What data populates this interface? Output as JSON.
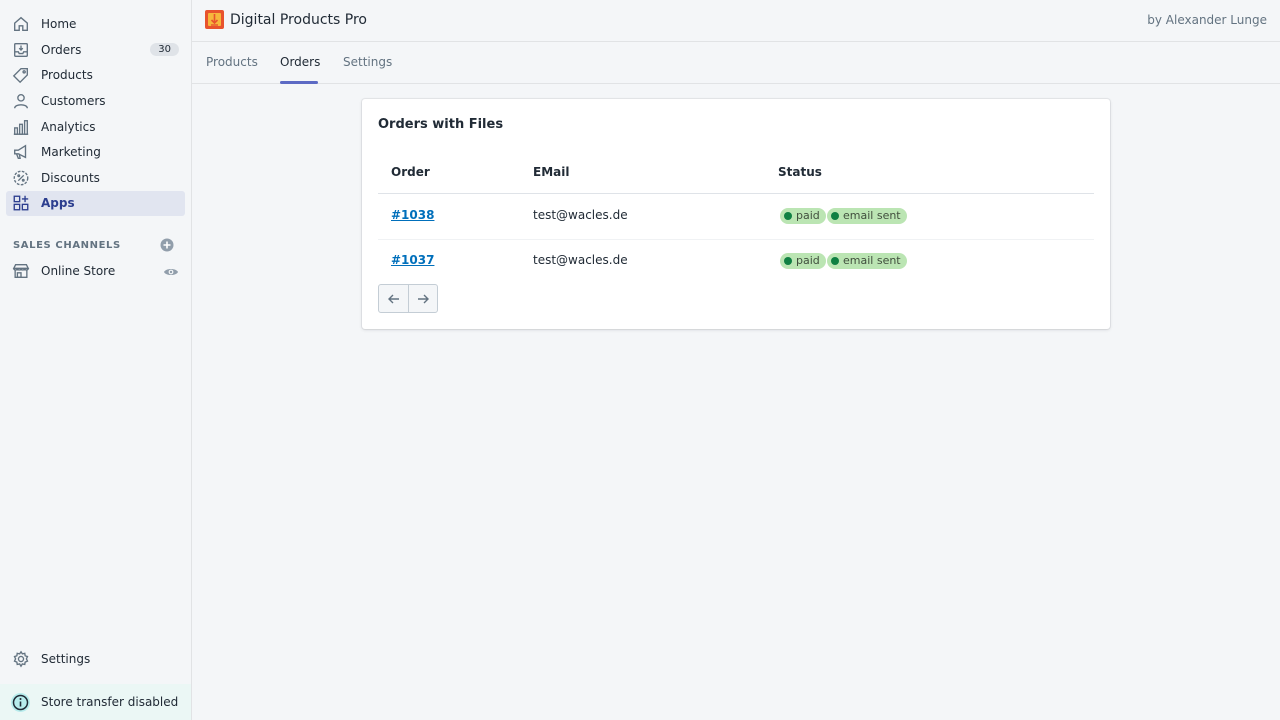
{
  "sidebar": {
    "items": [
      {
        "label": "Home",
        "icon": "home-icon"
      },
      {
        "label": "Orders",
        "icon": "orders-icon",
        "badge": "30"
      },
      {
        "label": "Products",
        "icon": "tag-icon"
      },
      {
        "label": "Customers",
        "icon": "person-icon"
      },
      {
        "label": "Analytics",
        "icon": "bar-chart-icon"
      },
      {
        "label": "Marketing",
        "icon": "megaphone-icon"
      },
      {
        "label": "Discounts",
        "icon": "discount-icon"
      },
      {
        "label": "Apps",
        "icon": "apps-icon",
        "active": true
      }
    ],
    "sales_channels_heading": "SALES CHANNELS",
    "online_store_label": "Online Store",
    "settings_label": "Settings",
    "store_transfer_label": "Store transfer disabled"
  },
  "header": {
    "app_title": "Digital Products Pro",
    "author": "by Alexander Lunge"
  },
  "tabs": [
    {
      "label": "Products"
    },
    {
      "label": "Orders",
      "active": true
    },
    {
      "label": "Settings"
    }
  ],
  "card": {
    "title": "Orders with Files",
    "columns": [
      "Order",
      "EMail",
      "Status"
    ],
    "rows": [
      {
        "order": "#1038",
        "email": "test@wacles.de",
        "statuses": [
          "paid",
          "email sent"
        ]
      },
      {
        "order": "#1037",
        "email": "test@wacles.de",
        "statuses": [
          "paid",
          "email sent"
        ]
      }
    ]
  },
  "colors": {
    "accent": "#5c6ac4",
    "link": "#006fbb",
    "status_pill": "#bbe5b3",
    "status_dot": "#108043",
    "active_nav_bg": "#e1e5f0"
  }
}
